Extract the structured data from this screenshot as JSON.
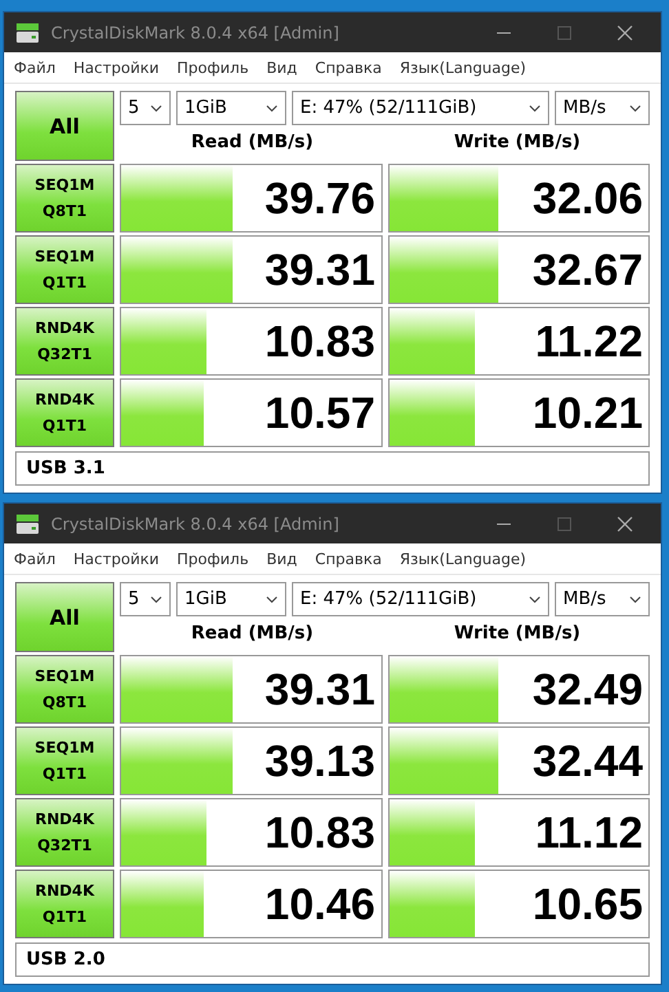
{
  "windows": [
    {
      "title": "CrystalDiskMark 8.0.4 x64 [Admin]",
      "menu": [
        "Файл",
        "Настройки",
        "Профиль",
        "Вид",
        "Справка",
        "Язык(Language)"
      ],
      "all_button": "All",
      "dropdowns": [
        "5",
        "1GiB",
        "E: 47% (52/111GiB)",
        "MB/s"
      ],
      "headers": [
        "Read (MB/s)",
        "Write (MB/s)"
      ],
      "rows": [
        {
          "test": "SEQ1M\nQ8T1",
          "read": {
            "value": "39.76",
            "level": 0.43
          },
          "write": {
            "value": "32.06",
            "level": 0.42
          }
        },
        {
          "test": "SEQ1M\nQ1T1",
          "read": {
            "value": "39.31",
            "level": 0.43
          },
          "write": {
            "value": "32.67",
            "level": 0.42
          }
        },
        {
          "test": "RND4K\nQ32T1",
          "read": {
            "value": "10.83",
            "level": 0.33
          },
          "write": {
            "value": "11.22",
            "level": 0.33
          }
        },
        {
          "test": "RND4K\nQ1T1",
          "read": {
            "value": "10.57",
            "level": 0.32
          },
          "write": {
            "value": "10.21",
            "level": 0.33
          }
        }
      ],
      "comment": "USB 3.1"
    },
    {
      "title": "CrystalDiskMark 8.0.4 x64 [Admin]",
      "menu": [
        "Файл",
        "Настройки",
        "Профиль",
        "Вид",
        "Справка",
        "Язык(Language)"
      ],
      "all_button": "All",
      "dropdowns": [
        "5",
        "1GiB",
        "E: 47% (52/111GiB)",
        "MB/s"
      ],
      "headers": [
        "Read (MB/s)",
        "Write (MB/s)"
      ],
      "rows": [
        {
          "test": "SEQ1M\nQ8T1",
          "read": {
            "value": "39.31",
            "level": 0.43
          },
          "write": {
            "value": "32.49",
            "level": 0.42
          }
        },
        {
          "test": "SEQ1M\nQ1T1",
          "read": {
            "value": "39.13",
            "level": 0.43
          },
          "write": {
            "value": "32.44",
            "level": 0.42
          }
        },
        {
          "test": "RND4K\nQ32T1",
          "read": {
            "value": "10.83",
            "level": 0.33
          },
          "write": {
            "value": "11.12",
            "level": 0.33
          }
        },
        {
          "test": "RND4K\nQ1T1",
          "read": {
            "value": "10.46",
            "level": 0.32
          },
          "write": {
            "value": "10.65",
            "level": 0.33
          }
        }
      ],
      "comment": "USB 2.0"
    }
  ]
}
